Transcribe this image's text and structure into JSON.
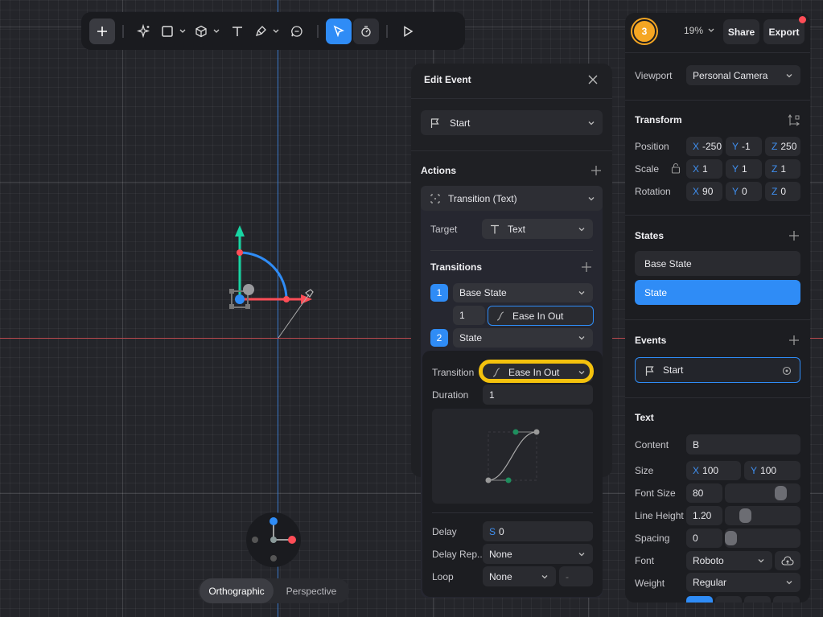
{
  "toolbar": {
    "tools": [
      "add-icon",
      "sparkle-icon",
      "rectangle-icon",
      "cube-icon",
      "text-icon",
      "pen-icon",
      "comment-icon",
      "select-icon",
      "animate-icon",
      "play-icon"
    ]
  },
  "gizmo": {
    "view_modes": [
      "Orthographic",
      "Perspective"
    ],
    "active_view": "Orthographic"
  },
  "edit_event": {
    "title": "Edit Event",
    "trigger": "Start",
    "actions_title": "Actions",
    "action": "Transition (Text)",
    "target_label": "Target",
    "target_value": "Text",
    "transitions_title": "Transitions",
    "transitions": [
      {
        "index": "1",
        "state": "Base State",
        "duration": "1",
        "easing": "Ease In Out"
      },
      {
        "index": "2",
        "state": "State"
      }
    ],
    "detail": {
      "transition_label": "Transition",
      "transition_value": "Ease In Out",
      "duration_label": "Duration",
      "duration_value": "1",
      "delay_label": "Delay",
      "delay_prefix": "S",
      "delay_value": "0",
      "delay_repeat_label": "Delay Rep...",
      "delay_repeat_value": "None",
      "loop_label": "Loop",
      "loop_value": "None",
      "loop_extra": "-"
    }
  },
  "right_panel": {
    "avatar_text": "3",
    "zoom": "19%",
    "share_label": "Share",
    "export_label": "Export",
    "viewport_label": "Viewport",
    "viewport_value": "Personal Camera",
    "transform_title": "Transform",
    "position_label": "Position",
    "position": {
      "x": "-250",
      "y": "-1",
      "z": "250"
    },
    "scale_label": "Scale",
    "scale": {
      "x": "1",
      "y": "1",
      "z": "1"
    },
    "rotation_label": "Rotation",
    "rotation": {
      "x": "90",
      "y": "0",
      "z": "0"
    },
    "states_title": "States",
    "states": [
      "Base State",
      "State"
    ],
    "events_title": "Events",
    "event": "Start",
    "text_title": "Text",
    "content_label": "Content",
    "content_value": "B",
    "size_label": "Size",
    "size": {
      "x": "100",
      "y": "100"
    },
    "font_size_label": "Font Size",
    "font_size_value": "80",
    "line_height_label": "Line Height",
    "line_height_value": "1.20",
    "spacing_label": "Spacing",
    "spacing_value": "0",
    "font_label": "Font",
    "font_value": "Roboto",
    "weight_label": "Weight",
    "weight_value": "Regular"
  },
  "colors": {
    "accent": "#2f8cf6",
    "highlight": "#f4c20d",
    "avatar": "#f5a623",
    "notify": "#ff4d57"
  }
}
